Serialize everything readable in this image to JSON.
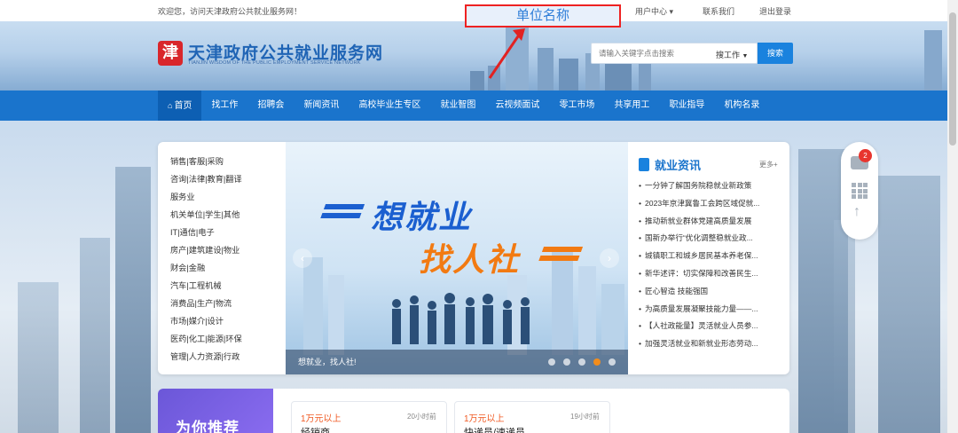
{
  "topbar": {
    "welcome": "欢迎您，访问天津政府公共就业服务网！",
    "user_center": "用户中心",
    "contact": "联系我们",
    "logout": "退出登录"
  },
  "annotation": {
    "label": "单位名称",
    "color": "#e22222"
  },
  "header": {
    "logo_char": "津",
    "site_title": "天津政府公共就业服务网",
    "site_subtitle": "TIANJIN WISDOM OF THE PUBLIC EMPLOYMENT SERVICE NETWORK",
    "search_placeholder": "请输入关键字点击搜索",
    "search_scope": "搜工作",
    "search_button": "搜索"
  },
  "nav": {
    "items": [
      {
        "label": "首页"
      },
      {
        "label": "找工作"
      },
      {
        "label": "招聘会"
      },
      {
        "label": "新闻资讯"
      },
      {
        "label": "高校毕业生专区"
      },
      {
        "label": "就业智图"
      },
      {
        "label": "云视频面试"
      },
      {
        "label": "零工市场"
      },
      {
        "label": "共享用工"
      },
      {
        "label": "职业指导"
      },
      {
        "label": "机构名录"
      }
    ]
  },
  "categories": [
    "销售|客服|采购",
    "咨询|法律|教育|翻译",
    "服务业",
    "机关单位|学生|其他",
    "IT|通信|电子",
    "房产|建筑建设|物业",
    "财会|金融",
    "汽车|工程机械",
    "消费品|生产|物流",
    "市场|媒介|设计",
    "医药|化工|能源|环保",
    "管理|人力资源|行政"
  ],
  "banner": {
    "slogan_line1": "想就业",
    "slogan_line2": "找人社",
    "caption": "想就业，找人社!",
    "prev": "‹",
    "next": "›",
    "dots_count": 5,
    "active_dot": 4
  },
  "news": {
    "title": "就业资讯",
    "more": "更多+",
    "items": [
      "一分钟了解国务院稳就业新政策",
      "2023年京津冀鲁工会跨区域促就...",
      "推动新就业群体党建高质量发展",
      "国新办举行“优化调整稳就业政...",
      "城镇职工和城乡居民基本养老保...",
      "新华述评：切实保障和改善民生...",
      "匠心智造 技能强国",
      "为高质量发展凝聚技能力量——...",
      "【人社政能量】灵活就业人员参...",
      "加强灵活就业和新就业形态劳动..."
    ]
  },
  "float_toolbar": {
    "badge": "2",
    "up_icon": "↑"
  },
  "recommend": {
    "title": "为你推荐",
    "jobs": [
      {
        "salary": "1万元以上",
        "time": "20小时前",
        "title": "经销商"
      },
      {
        "salary": "1万元以上",
        "time": "19小时前",
        "title": "快递员/速递员"
      }
    ]
  }
}
